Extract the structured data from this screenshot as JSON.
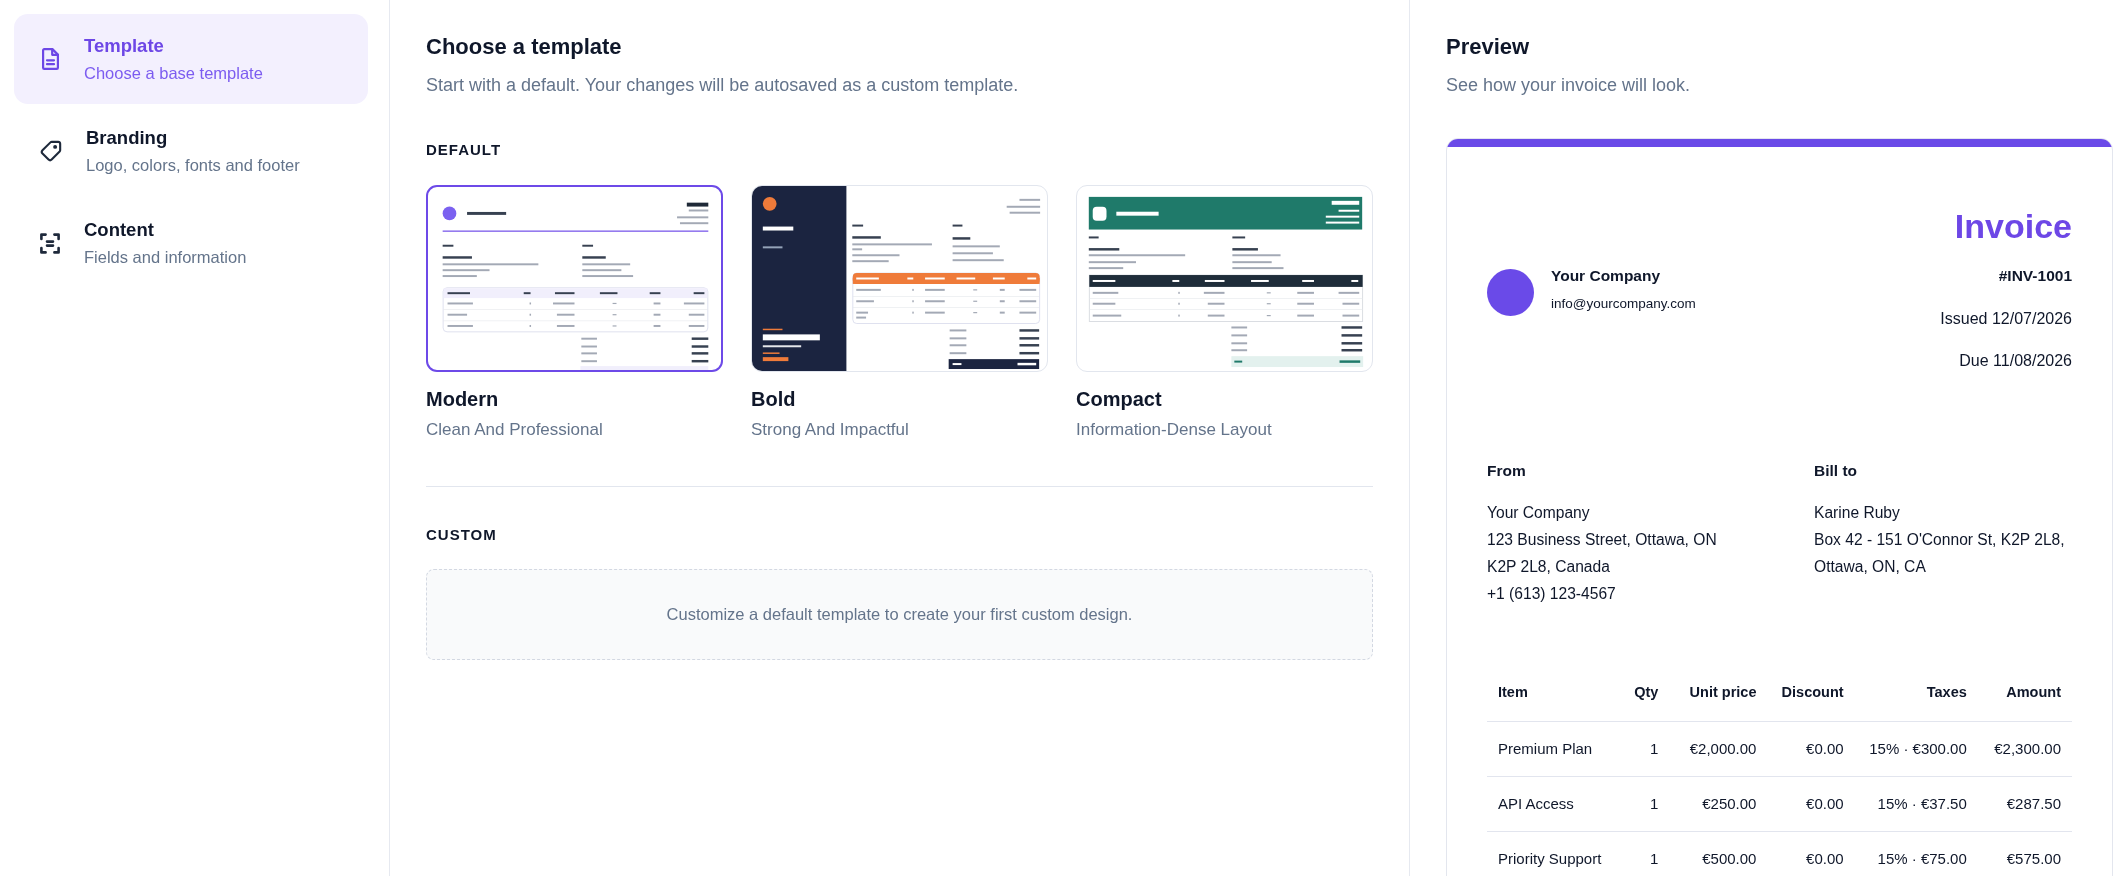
{
  "sidebar": {
    "items": [
      {
        "title": "Template",
        "subtitle": "Choose a base template",
        "selected": true
      },
      {
        "title": "Branding",
        "subtitle": "Logo, colors, fonts and footer",
        "selected": false
      },
      {
        "title": "Content",
        "subtitle": "Fields and information",
        "selected": false
      }
    ]
  },
  "main": {
    "title": "Choose a template",
    "subtitle": "Start with a default. Your changes will be autosaved as a custom template.",
    "default_section": {
      "label": "DEFAULT",
      "templates": [
        {
          "kind": "modern",
          "name": "Modern",
          "description": "Clean And Professional",
          "selected": true
        },
        {
          "kind": "bold",
          "name": "Bold",
          "description": "Strong And Impactful",
          "selected": false
        },
        {
          "kind": "compact",
          "name": "Compact",
          "description": "Information-Dense Layout",
          "selected": false
        }
      ]
    },
    "custom_section": {
      "label": "CUSTOM",
      "empty_message": "Customize a default template to create your first custom design."
    }
  },
  "preview": {
    "title": "Preview",
    "subtitle": "See how your invoice will look.",
    "invoice": {
      "heading": "Invoice",
      "company_name": "Your Company",
      "company_email": "info@yourcompany.com",
      "number": "#INV-1001",
      "issued": "Issued 12/07/2026",
      "due": "Due 11/08/2026",
      "from": {
        "label": "From",
        "lines": [
          "Your Company",
          "123 Business Street, Ottawa, ON",
          "K2P 2L8, Canada",
          "+1 (613) 123-4567"
        ]
      },
      "bill_to": {
        "label": "Bill to",
        "lines": [
          "Karine Ruby",
          "Box 42 - 151 O'Connor St, K2P 2L8,",
          "Ottawa, ON, CA"
        ]
      },
      "table": {
        "columns": [
          "Item",
          "Qty",
          "Unit price",
          "Discount",
          "Taxes",
          "Amount"
        ],
        "rows": [
          [
            "Premium Plan",
            "1",
            "€2,000.00",
            "€0.00",
            "15% · €300.00",
            "€2,300.00"
          ],
          [
            "API Access",
            "1",
            "€250.00",
            "€0.00",
            "15% · €37.50",
            "€287.50"
          ],
          [
            "Priority Support",
            "1",
            "€500.00",
            "€0.00",
            "15% · €75.00",
            "€575.00"
          ]
        ]
      }
    }
  }
}
